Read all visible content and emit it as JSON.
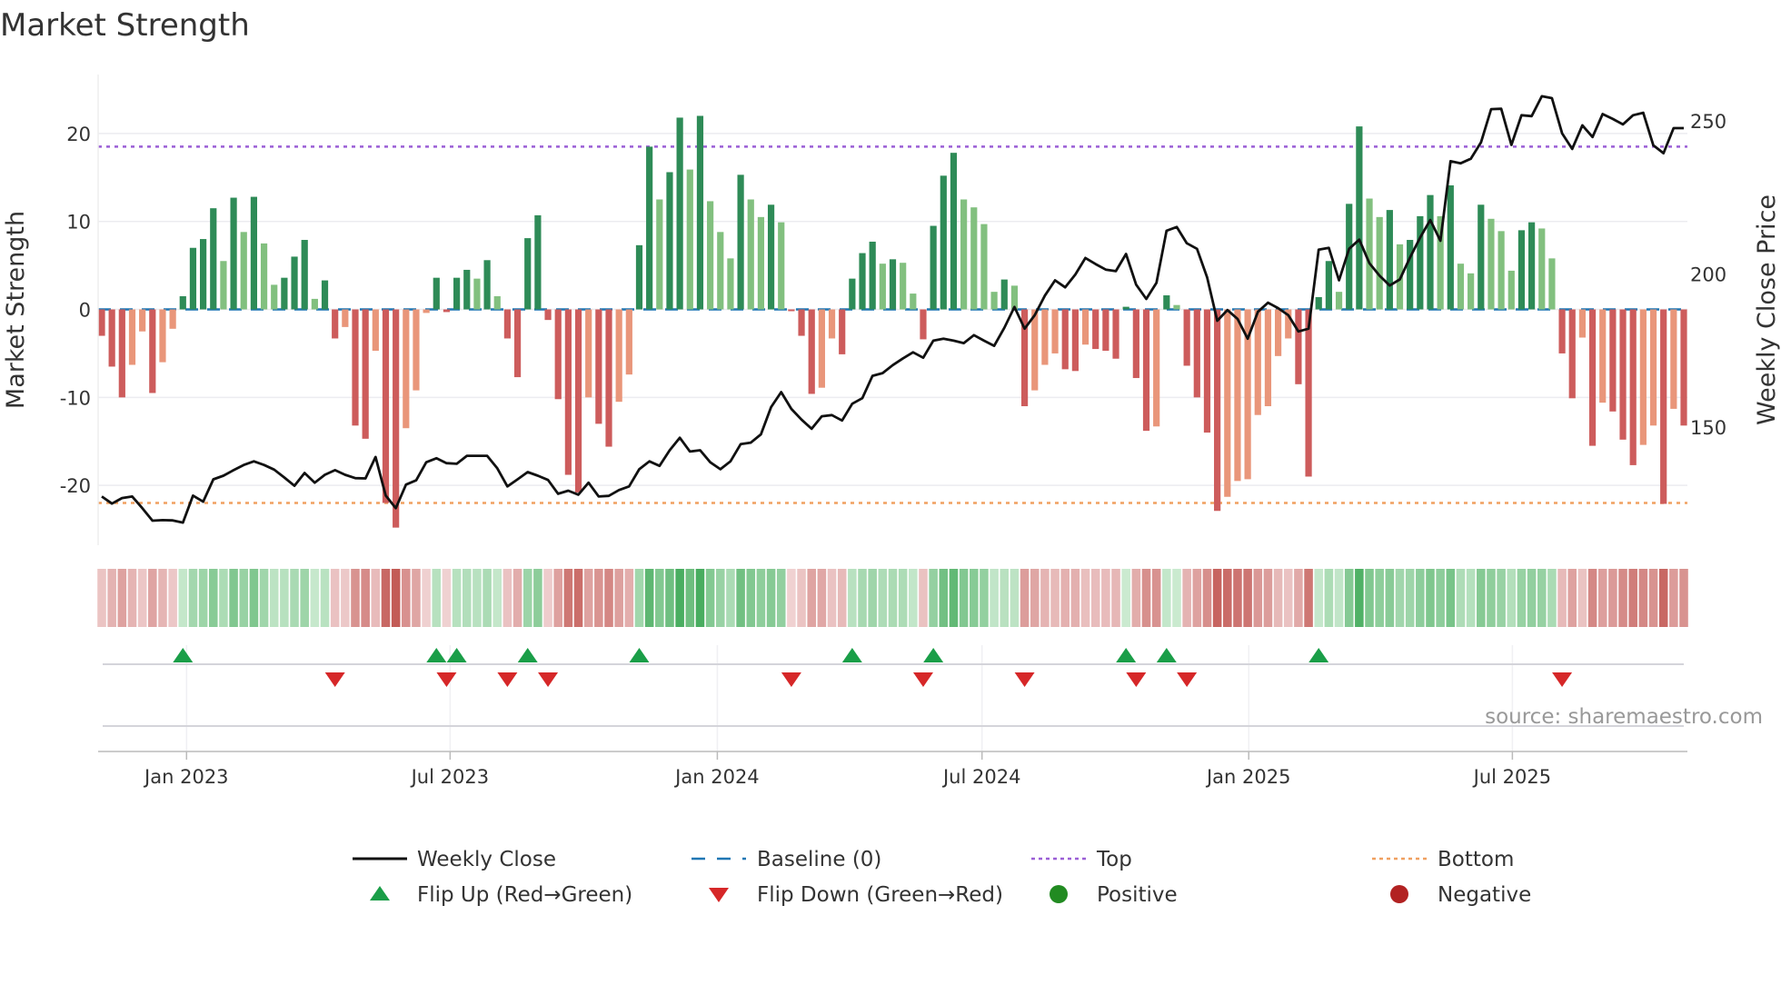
{
  "chart_data": {
    "type": "bar",
    "title": "Market Strength",
    "ylabel": "Market Strength",
    "y2label": "Weekly Close Price",
    "ylim": [
      -26.8,
      26.7
    ],
    "y2lim": [
      111.4,
      265.1
    ],
    "yticks": [
      -20,
      -10,
      0,
      10,
      20
    ],
    "y2ticks": [
      150,
      200,
      250
    ],
    "grid": true,
    "top_level": 18.5,
    "bottom_level": -22,
    "baseline": 0,
    "x_unit": "weeks from first bar",
    "xticks": [
      {
        "label": "Jan 2023",
        "week": 8.36
      },
      {
        "label": "Jul 2023",
        "week": 34.35
      },
      {
        "label": "Jan 2024",
        "week": 60.7
      },
      {
        "label": "Jul 2024",
        "week": 86.8
      },
      {
        "label": "Jan 2025",
        "week": 113.1
      },
      {
        "label": "Jul 2025",
        "week": 139.1
      }
    ],
    "strength": [
      -3,
      -6.5,
      -10,
      -6.3,
      -2.5,
      -9.5,
      -6,
      -2.2,
      1.5,
      7,
      8,
      11.5,
      5.5,
      12.7,
      8.8,
      12.8,
      7.5,
      2.8,
      3.6,
      6,
      7.9,
      1.2,
      3.3,
      -3.3,
      -2,
      -13.2,
      -14.7,
      -4.7,
      -22,
      -24.8,
      -13.5,
      -9.2,
      -0.4,
      3.6,
      -0.3,
      3.6,
      4.5,
      3.5,
      5.6,
      1.5,
      -3.3,
      -7.7,
      8.1,
      10.7,
      -1.2,
      -10.2,
      -18.8,
      -20.8,
      -10,
      -13,
      -15.6,
      -10.5,
      -7.4,
      7.3,
      18.5,
      12.5,
      15.6,
      21.8,
      15.9,
      22,
      12.3,
      8.8,
      5.8,
      15.3,
      12.5,
      10.5,
      11.9,
      9.9,
      -0.2,
      -3,
      -9.6,
      -8.9,
      -3.3,
      -5.1,
      3.5,
      6.4,
      7.7,
      5.2,
      5.7,
      5.3,
      1.8,
      -3.4,
      9.5,
      15.2,
      17.8,
      12.5,
      11.6,
      9.7,
      2,
      3.4,
      2.7,
      -11,
      -9.2,
      -6.3,
      -5,
      -6.8,
      -7,
      -4,
      -4.5,
      -4.7,
      -5.6,
      0.3,
      -7.8,
      -13.8,
      -13.3,
      1.6,
      0.5,
      -6.4,
      -10,
      -14,
      -22.9,
      -21.3,
      -19.5,
      -19.3,
      -12,
      -11,
      -5.3,
      -3.3,
      -8.5,
      -19,
      1.4,
      5.5,
      2,
      12,
      20.8,
      12.6,
      10.5,
      11.3,
      7.4,
      7.9,
      10.6,
      13,
      10.6,
      14.1,
      5.2,
      4.1,
      11.9,
      10.3,
      8.9,
      4.4,
      9,
      9.9,
      9.2,
      5.8,
      -5,
      -10.1,
      -3.2,
      -15.5,
      -10.6,
      -11.6,
      -14.8,
      -17.7,
      -15.4,
      -13.2,
      -22.1,
      -11.3,
      -13.2
    ],
    "weekly_close": [
      127.3,
      125,
      126.8,
      127.3,
      123.5,
      119.4,
      119.6,
      119.5,
      118.8,
      127.6,
      125.6,
      132.9,
      134.1,
      135.9,
      137.6,
      138.8,
      137.6,
      136.1,
      133.5,
      130.8,
      135,
      131.8,
      134.4,
      135.9,
      134.4,
      133.3,
      133.2,
      140.2,
      127.6,
      123.5,
      131.2,
      132.6,
      138.5,
      139.8,
      138.2,
      138,
      140.6,
      140.6,
      140.6,
      136.5,
      130.6,
      132.9,
      135.3,
      134.1,
      132.7,
      128.2,
      129.2,
      127.9,
      131.8,
      127.3,
      127.5,
      129.4,
      130.6,
      136.2,
      138.8,
      137.3,
      142.4,
      146.5,
      142,
      142.4,
      138.5,
      136.2,
      138.8,
      144.4,
      144.9,
      147.6,
      156.5,
      161.4,
      155.9,
      152.4,
      149.4,
      153.5,
      153.9,
      152.1,
      157.6,
      159.4,
      166.7,
      167.6,
      170.2,
      172.4,
      174.4,
      172.6,
      178.2,
      178.8,
      178.2,
      177.4,
      180,
      178.2,
      176.5,
      182.4,
      189.2,
      182.1,
      186.5,
      192.9,
      197.9,
      195.6,
      199.8,
      205.2,
      203.2,
      201.4,
      200.9,
      206.5,
      196.5,
      191.8,
      197.1,
      214.1,
      215.3,
      210,
      208.2,
      198.8,
      184.7,
      188.2,
      185.3,
      178.8,
      187.6,
      190.6,
      188.8,
      186.5,
      181.2,
      182.1,
      207.9,
      208.5,
      197.9,
      208.2,
      211.2,
      203.5,
      199.4,
      196.2,
      198.2,
      205.3,
      211.8,
      217.6,
      210.8,
      236.8,
      236.1,
      237.6,
      242.9,
      253.8,
      253.9,
      242.1,
      251.8,
      251.5,
      258,
      257.4,
      245.9,
      240.8,
      248.5,
      244.7,
      252.2,
      250.6,
      248.8,
      251.8,
      252.6,
      242,
      239.4,
      247.6,
      247.6
    ],
    "flip_up_weeks": [
      8,
      33,
      35,
      42,
      53,
      74,
      82,
      101,
      105,
      120
    ],
    "flip_down_weeks": [
      23,
      34,
      40,
      44,
      68,
      81,
      91,
      102,
      107,
      144
    ],
    "source_note": "source: sharemaestro.com",
    "legend": [
      {
        "label": "Weekly Close",
        "symbol": "line",
        "color": "#111111"
      },
      {
        "label": "Baseline (0)",
        "symbol": "dash",
        "color": "#1f77b4"
      },
      {
        "label": "Top",
        "symbol": "dot",
        "color": "#9b5fd6"
      },
      {
        "label": "Bottom",
        "symbol": "dot",
        "color": "#f0a060"
      },
      {
        "label": "Flip Up (Red→Green)",
        "symbol": "triangle-up",
        "color": "#1a9e48"
      },
      {
        "label": "Flip Down (Green→Red)",
        "symbol": "triangle-down",
        "color": "#d62728"
      },
      {
        "label": "Positive",
        "symbol": "circle",
        "color": "#228b22"
      },
      {
        "label": "Negative",
        "symbol": "circle",
        "color": "#b22222"
      }
    ],
    "colors": {
      "pos_strong": "#2e8b57",
      "pos_weak": "#82c07f",
      "neg_strong": "#cd5c5c",
      "neg_weak": "#e9967a",
      "grid": "#ececf0",
      "axis": "#cccccc"
    }
  }
}
